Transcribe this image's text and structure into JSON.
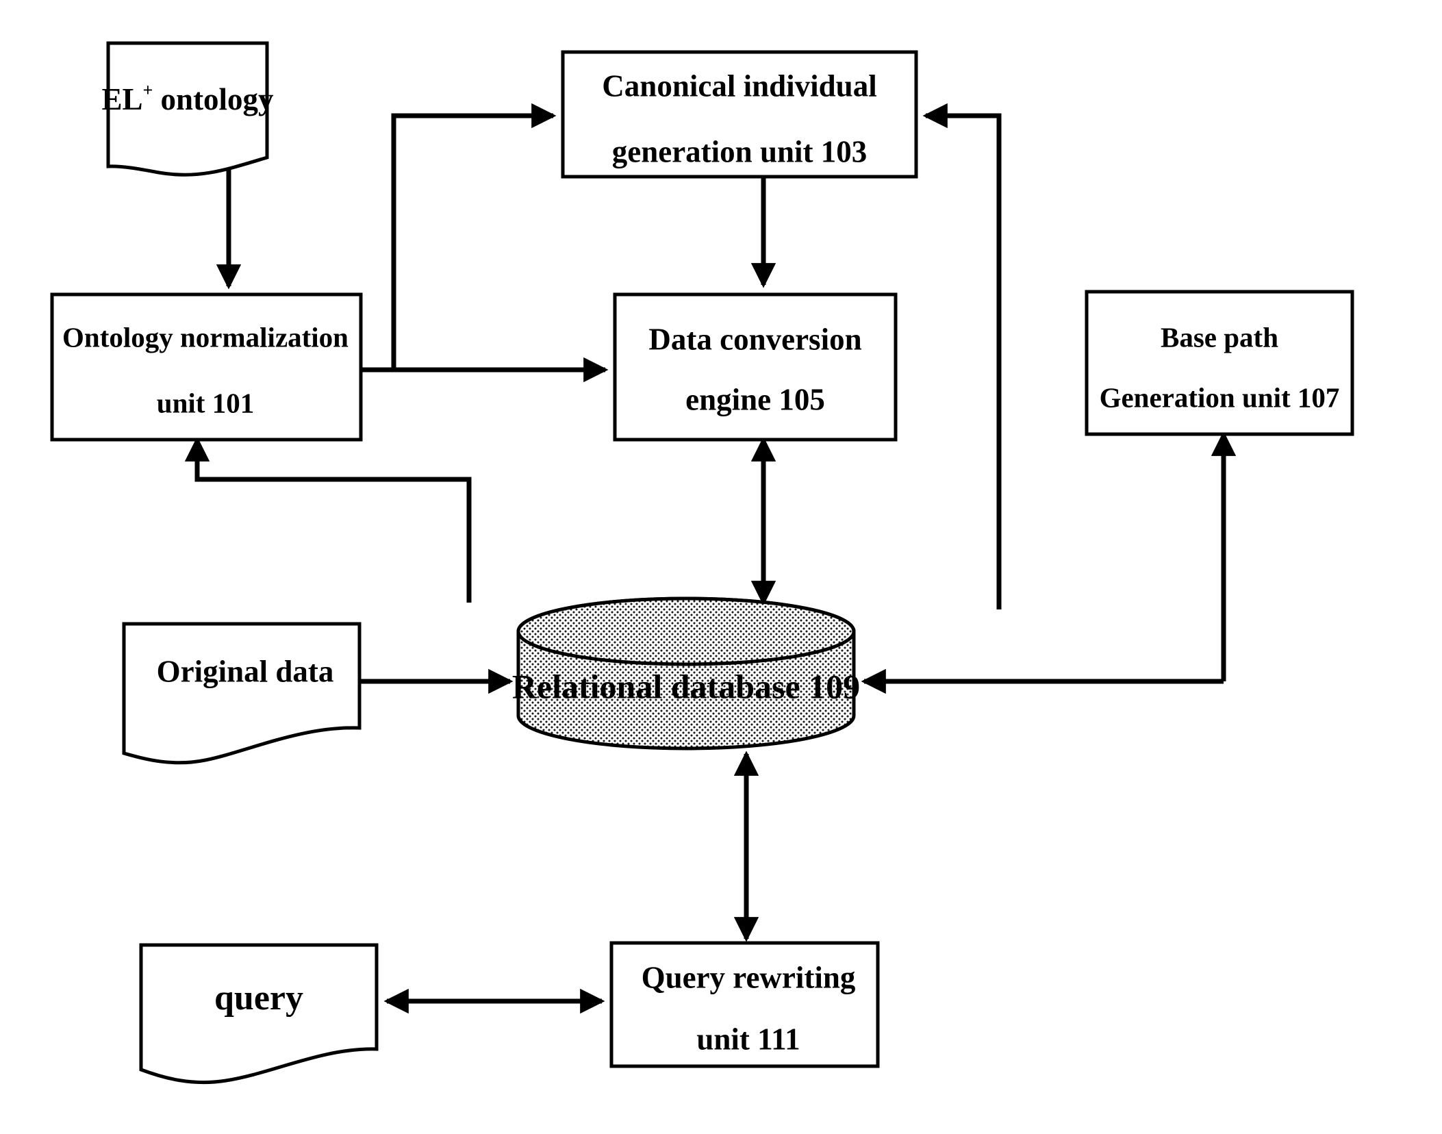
{
  "diagram": {
    "title": "Ontology to relational database conversion system",
    "colors": {
      "stroke": "#000000",
      "fill": "#ffffff",
      "database_fill": "#d8d8d8"
    },
    "nodes": {
      "el_ontology": {
        "label_main": "EL",
        "label_sup": "+",
        "label_rest": " ontology",
        "shape": "document"
      },
      "canonical_unit": {
        "line1": "Canonical individual",
        "line2": "generation unit 103",
        "shape": "rectangle"
      },
      "ontology_normalization": {
        "line1": "Ontology normalization",
        "line2": "unit 101",
        "shape": "rectangle"
      },
      "data_conversion": {
        "line1": "Data conversion",
        "line2": "engine 105",
        "shape": "rectangle"
      },
      "base_path": {
        "line1": "Base path",
        "line2": "Generation unit 107",
        "shape": "rectangle"
      },
      "relational_database": {
        "label": "Relational database 109",
        "shape": "cylinder"
      },
      "original_data": {
        "label": "Original data",
        "shape": "document"
      },
      "query": {
        "label": "query",
        "shape": "document"
      },
      "query_rewriting": {
        "line1": "Query rewriting",
        "line2": "unit 111",
        "shape": "rectangle"
      }
    },
    "edges": [
      {
        "name": "el-ontology-to-normalization",
        "from": "el_ontology",
        "to": "ontology_normalization",
        "arrow": "single"
      },
      {
        "name": "normalization-to-canonical",
        "from": "ontology_normalization",
        "to": "canonical_unit",
        "arrow": "single"
      },
      {
        "name": "normalization-to-data-conversion",
        "from": "ontology_normalization",
        "to": "data_conversion",
        "arrow": "single"
      },
      {
        "name": "canonical-to-data-conversion",
        "from": "canonical_unit",
        "to": "data_conversion",
        "arrow": "single"
      },
      {
        "name": "database-to-canonical",
        "from": "relational_database",
        "to": "canonical_unit",
        "arrow": "single"
      },
      {
        "name": "database-to-normalization",
        "from": "relational_database",
        "to": "ontology_normalization",
        "arrow": "single"
      },
      {
        "name": "data-conversion-database",
        "from": "data_conversion",
        "to": "relational_database",
        "arrow": "double"
      },
      {
        "name": "original-data-to-database",
        "from": "original_data",
        "to": "relational_database",
        "arrow": "single"
      },
      {
        "name": "base-path-to-database",
        "from": "base_path",
        "to": "relational_database",
        "arrow": "single"
      },
      {
        "name": "database-to-base-path",
        "from": "relational_database",
        "to": "base_path",
        "arrow": "single"
      },
      {
        "name": "database-query-rewriting",
        "from": "relational_database",
        "to": "query_rewriting",
        "arrow": "double"
      },
      {
        "name": "query-query-rewriting",
        "from": "query",
        "to": "query_rewriting",
        "arrow": "double"
      }
    ]
  }
}
